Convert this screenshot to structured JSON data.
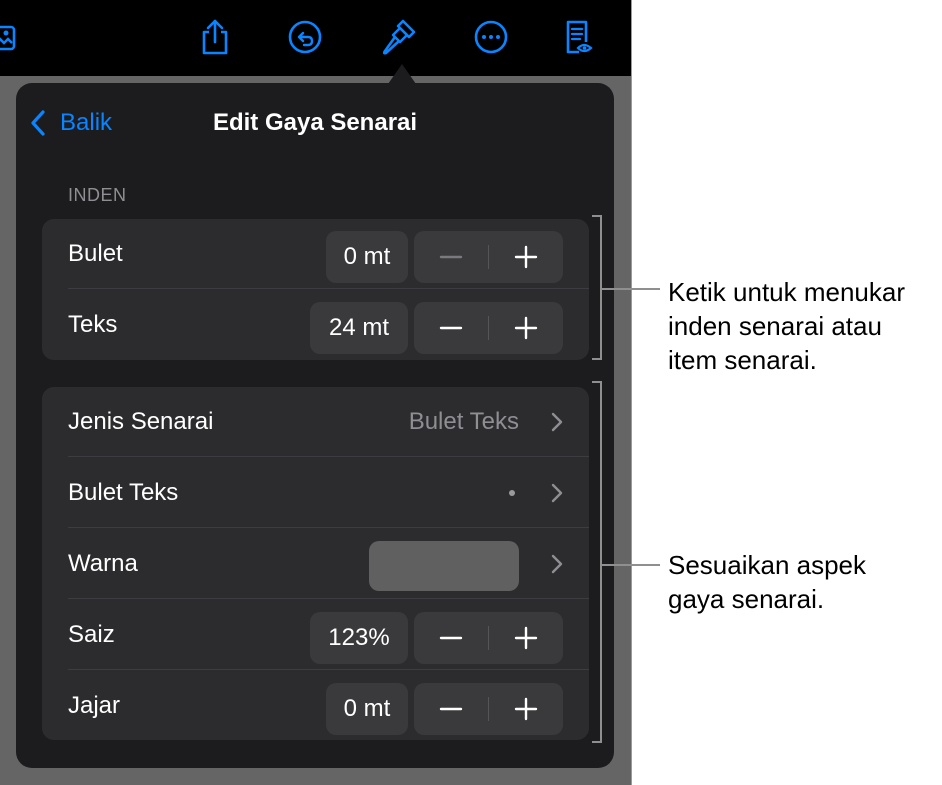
{
  "toolbar": {
    "icons": [
      "media-icon",
      "share-icon",
      "undo-icon",
      "format-brush-icon",
      "more-icon",
      "reader-view-icon"
    ]
  },
  "popover": {
    "back_label": "Balik",
    "title": "Edit Gaya Senarai",
    "indent_header": "INDEN",
    "indent_rows": [
      {
        "label": "Bulet",
        "value": "0 mt"
      },
      {
        "label": "Teks",
        "value": "24 mt"
      }
    ],
    "style_rows": {
      "list_type": {
        "label": "Jenis Senarai",
        "value": "Bulet Teks"
      },
      "text_bullet": {
        "label": "Bulet Teks",
        "value": "•"
      },
      "color": {
        "label": "Warna",
        "swatch": "#606060"
      },
      "size": {
        "label": "Saiz",
        "value": "123%"
      },
      "align": {
        "label": "Jajar",
        "value": "0 mt"
      }
    }
  },
  "callouts": {
    "indent": "Ketik untuk menukar\ninden senarai atau\nitem senarai.",
    "style": "Sesuaikan aspek\ngaya senarai."
  },
  "colors": {
    "accent": "#0a84ff",
    "popover_bg": "#1c1c1e",
    "row_bg": "#2c2c2e",
    "control_bg": "#3a3a3c",
    "dim_background": "#656565"
  }
}
